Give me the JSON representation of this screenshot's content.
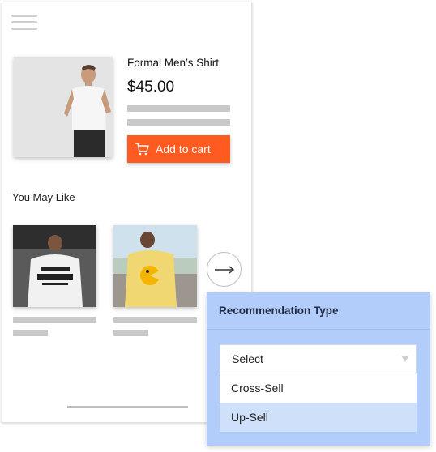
{
  "product": {
    "title": "Formal Men’s Shirt",
    "price": "$45.00",
    "add_to_cart_label": "Add to cart"
  },
  "recommendations": {
    "heading": "You May Like"
  },
  "panel": {
    "title": "Recommendation Type",
    "select_placeholder": "Select",
    "options": [
      "Cross-Sell",
      "Up-Sell"
    ],
    "highlighted_option": "Up-Sell"
  },
  "colors": {
    "accent": "#ff5a1f",
    "panel_bg": "#b3cdfb",
    "option_highlight": "#cfe0fb"
  },
  "icons": [
    "hamburger-menu-icon",
    "cart-icon",
    "arrow-right-icon",
    "chevron-down-icon"
  ]
}
